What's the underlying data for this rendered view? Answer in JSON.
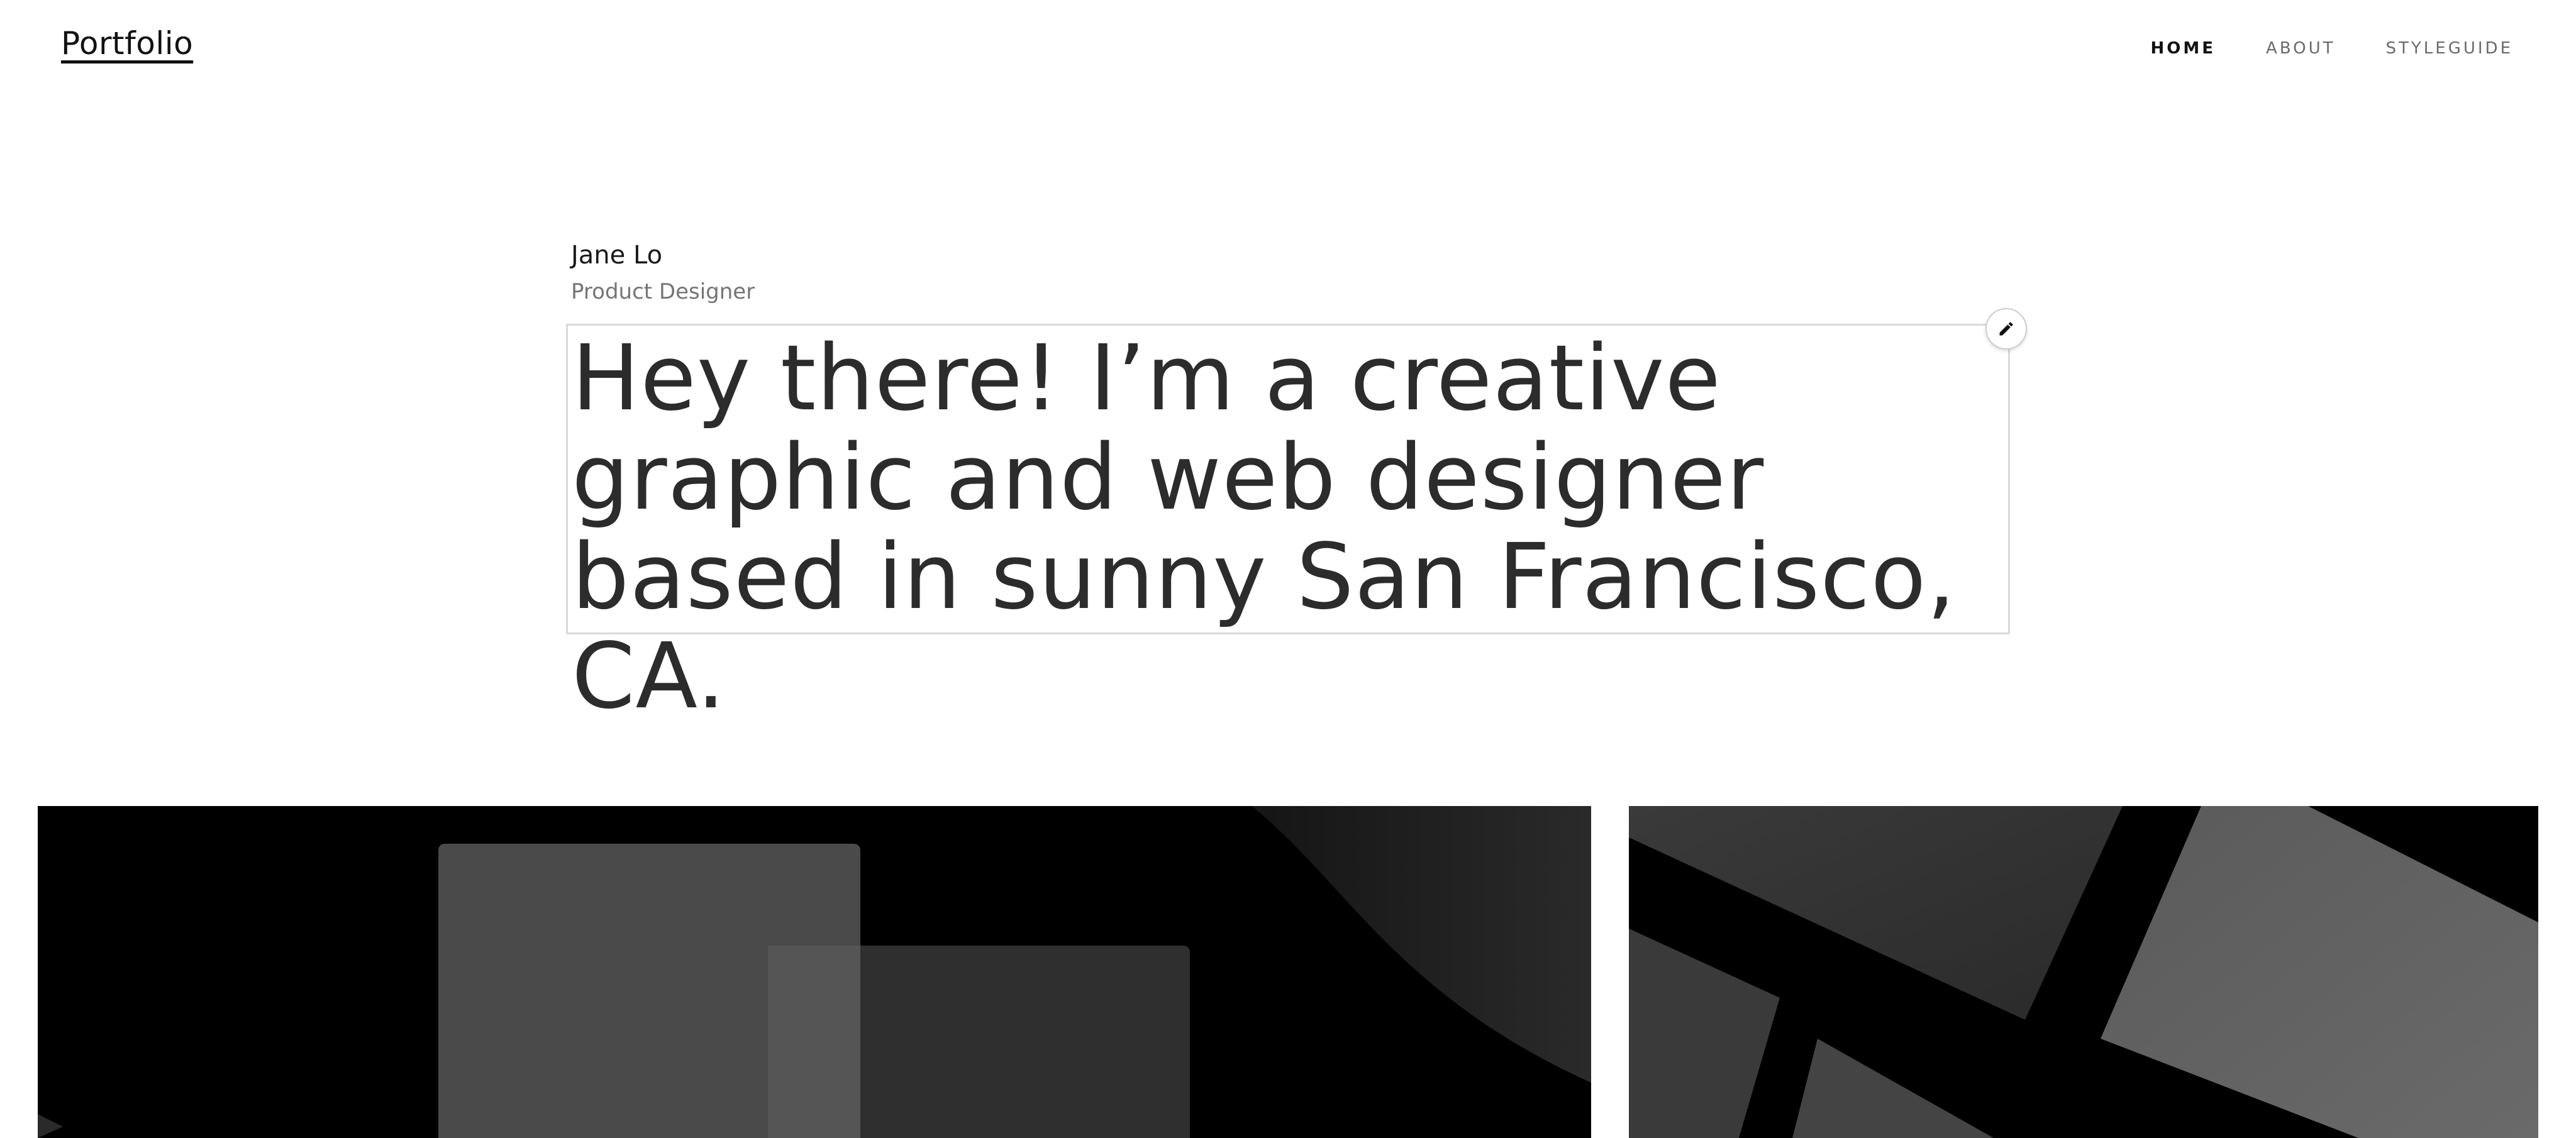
{
  "header": {
    "logo": "Portfolio",
    "nav": [
      {
        "label": "HOME",
        "active": true
      },
      {
        "label": "ABOUT",
        "active": false
      },
      {
        "label": "STYLEGUIDE",
        "active": false
      }
    ]
  },
  "intro": {
    "name": "Jane Lo",
    "role": "Product Designer",
    "bio": "Hey there! I’m a creative graphic and web designer based in sunny San Francisco, CA."
  },
  "edit": {
    "icon": "pencil-icon"
  },
  "projects": [
    {
      "name": "project-tile-1"
    },
    {
      "name": "project-tile-2"
    }
  ],
  "colors": {
    "text": "#2c2c2c",
    "nav_inactive": "#6a6a6a",
    "tile_bg": "#000000"
  }
}
